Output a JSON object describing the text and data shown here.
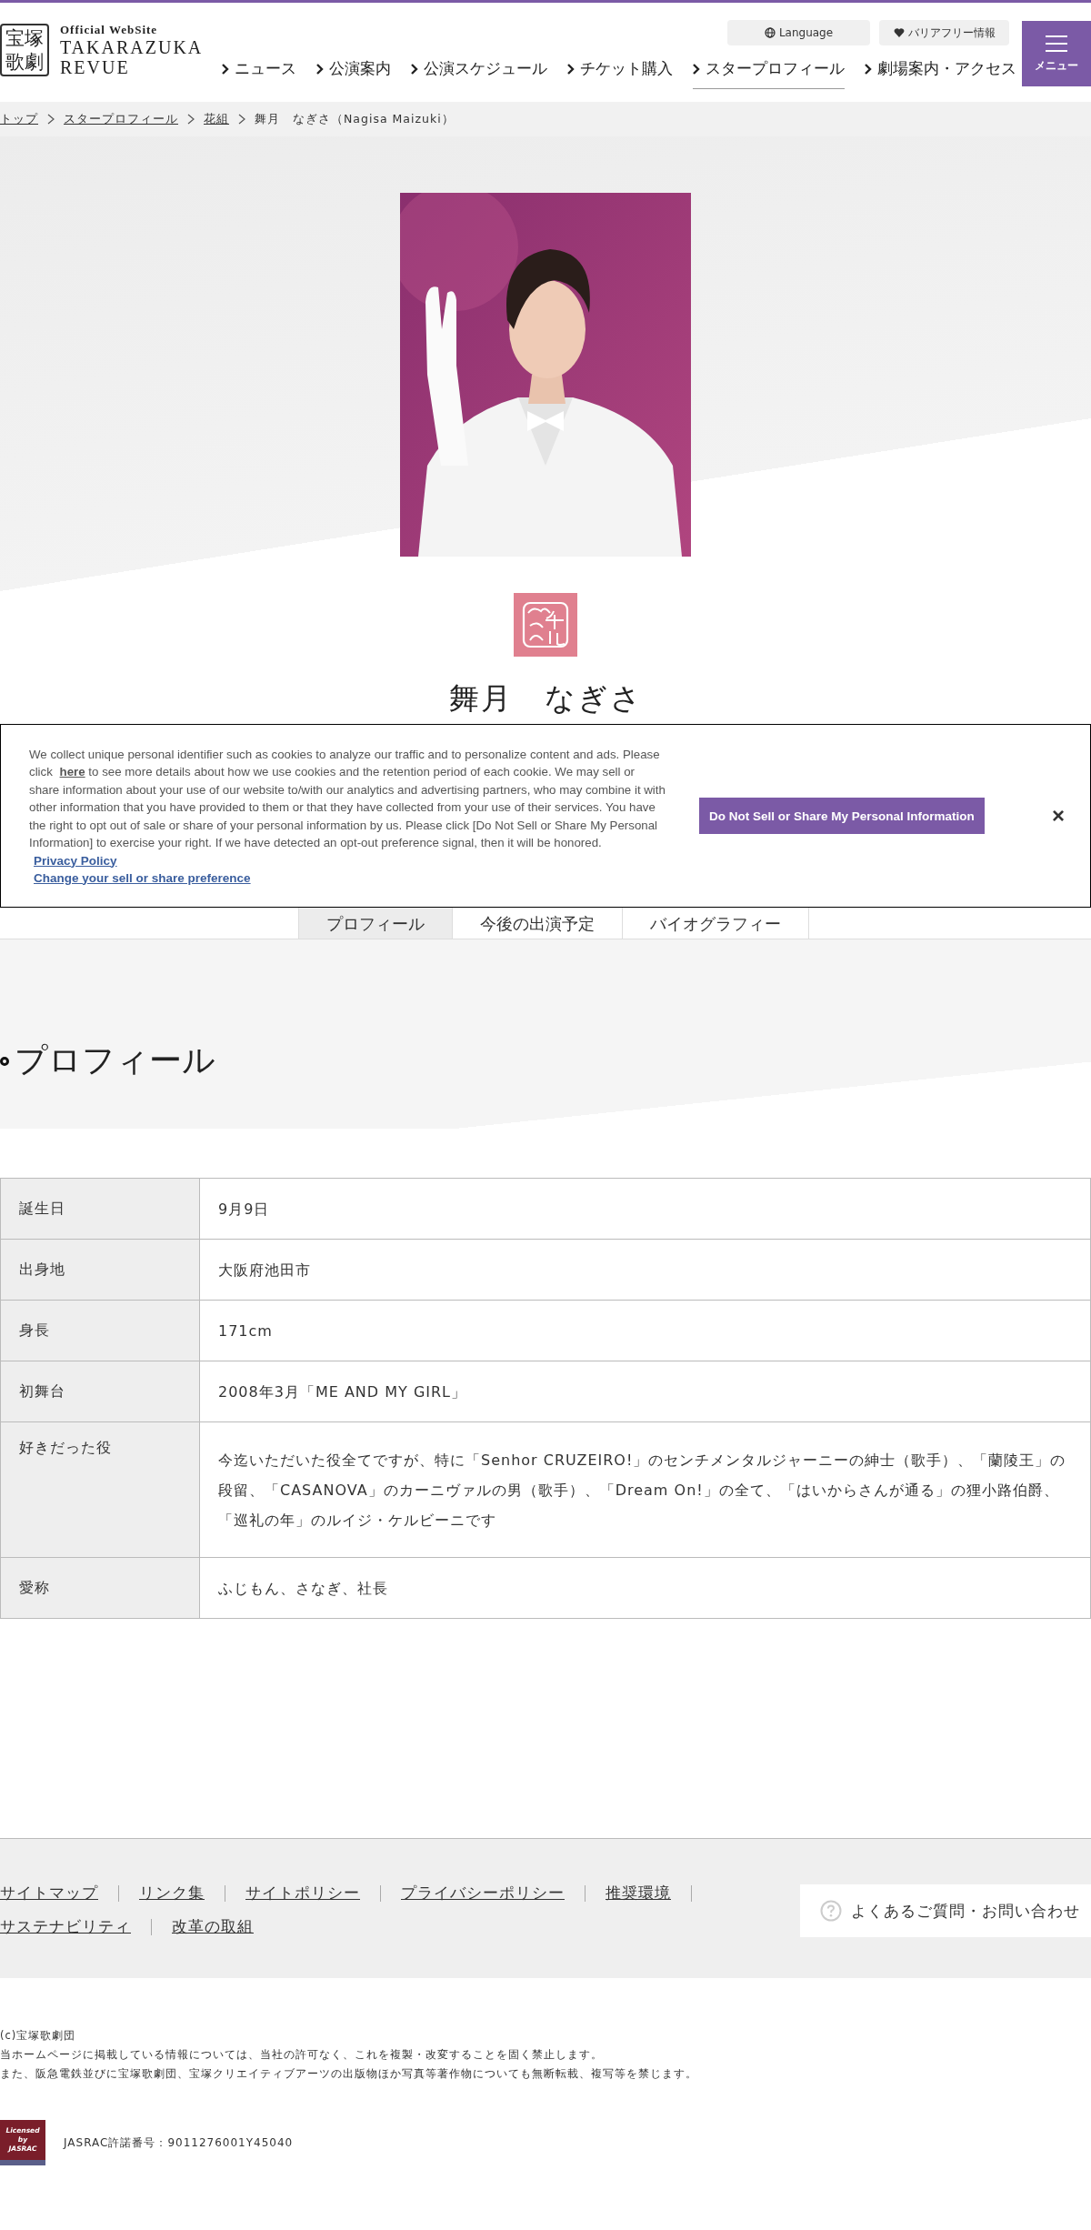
{
  "header": {
    "tagline": "Official WebSite",
    "title_lines": [
      "TAKARAZUKA",
      "REVUE"
    ],
    "logo_mark": "宝塚歌劇",
    "utility_buttons": [
      {
        "kind": "language",
        "label": "Language"
      },
      {
        "kind": "accessibility",
        "label": "バリアフリー情報"
      }
    ],
    "nav": [
      {
        "label": "ニュース",
        "selected": false
      },
      {
        "label": "公演案内",
        "selected": false
      },
      {
        "label": "公演スケジュール",
        "selected": false
      },
      {
        "label": "チケット購入",
        "selected": false
      },
      {
        "label": "スタープロフィール",
        "selected": true
      },
      {
        "label": "劇場案内・アクセス",
        "selected": false
      }
    ],
    "menu_button": "メニュー"
  },
  "breadcrumb": [
    {
      "label": "トップ",
      "link": true
    },
    {
      "label": "スタープロフィール",
      "link": true
    },
    {
      "label": "花組",
      "link": true
    },
    {
      "label": "舞月　なぎさ（Nagisa Maizuki）",
      "link": false
    }
  ],
  "star": {
    "name": "舞月　なぎさ"
  },
  "tabs": [
    {
      "label": "プロフィール",
      "selected": true
    },
    {
      "label": "今後の出演予定",
      "selected": false
    },
    {
      "label": "バイオグラフィー",
      "selected": false
    }
  ],
  "section_title": "プロフィール",
  "table": {
    "rows": [
      {
        "label": "誕生日",
        "value": "9月9日"
      },
      {
        "label": "出身地",
        "value": "大阪府池田市"
      },
      {
        "label": "身長",
        "value": "171cm"
      },
      {
        "label": "初舞台",
        "value": "2008年3月「ME AND MY GIRL」"
      },
      {
        "label": "好きだった役",
        "value": "今迄いただいた役全てですが、特に「Senhor CRUZEIRO!」のセンチメンタルジャーニーの紳士（歌手）、「蘭陵王」の段留、「CASANOVA」のカーニヴァルの男（歌手）、「Dream On!」の全て、「はいからさんが通る」の狸小路伯爵、「巡礼の年」のルイジ・ケルビーニです"
      },
      {
        "label": "愛称",
        "value": "ふじもん、さなぎ、社長"
      }
    ]
  },
  "footer": {
    "links": [
      "サイトマップ",
      "リンク集",
      "サイトポリシー",
      "プライバシーポリシー",
      "推奨環境",
      "サステナビリティ",
      "改革の取組"
    ],
    "faq_button": "よくあるご質問・お問い合わせ",
    "copyright": [
      "(c)宝塚歌劇団",
      "当ホームページに掲載している情報については、当社の許可なく、これを複製・改変することを固く禁止します。",
      "また、阪急電鉄並びに宝塚歌劇団、宝塚クリエイティブアーツの出版物ほか写真等著作物についても無断転載、複写等を禁じます。"
    ],
    "jasrac_badge": [
      "Licensed",
      "by",
      "JASRAC"
    ],
    "jasrac_permit": "JASRAC許諾番号：9011276001Y45040"
  },
  "cookie_banner": {
    "text_before": "We collect unique personal identifier such as cookies to analyze our traffic and to personalize content and ads. Please click ",
    "link_text": "here",
    "text_after": " to see more details about how we use cookies and the retention period of each cookie. We may sell or share information about your use of our website to/with our analytics and advertising partners, who may combine it with other information that you have provided to them or that they have collected from your use of their services. You have the right to opt out of sale or share of your personal information by us. Please click [Do Not Sell or Share My Personal Information] to exercise your right. If we have detected an opt-out preference signal, then it will be honored.",
    "links": [
      "Privacy Policy",
      "Change your sell or share preference"
    ],
    "button": "Do Not Sell or Share My Personal Information",
    "close": "×"
  }
}
